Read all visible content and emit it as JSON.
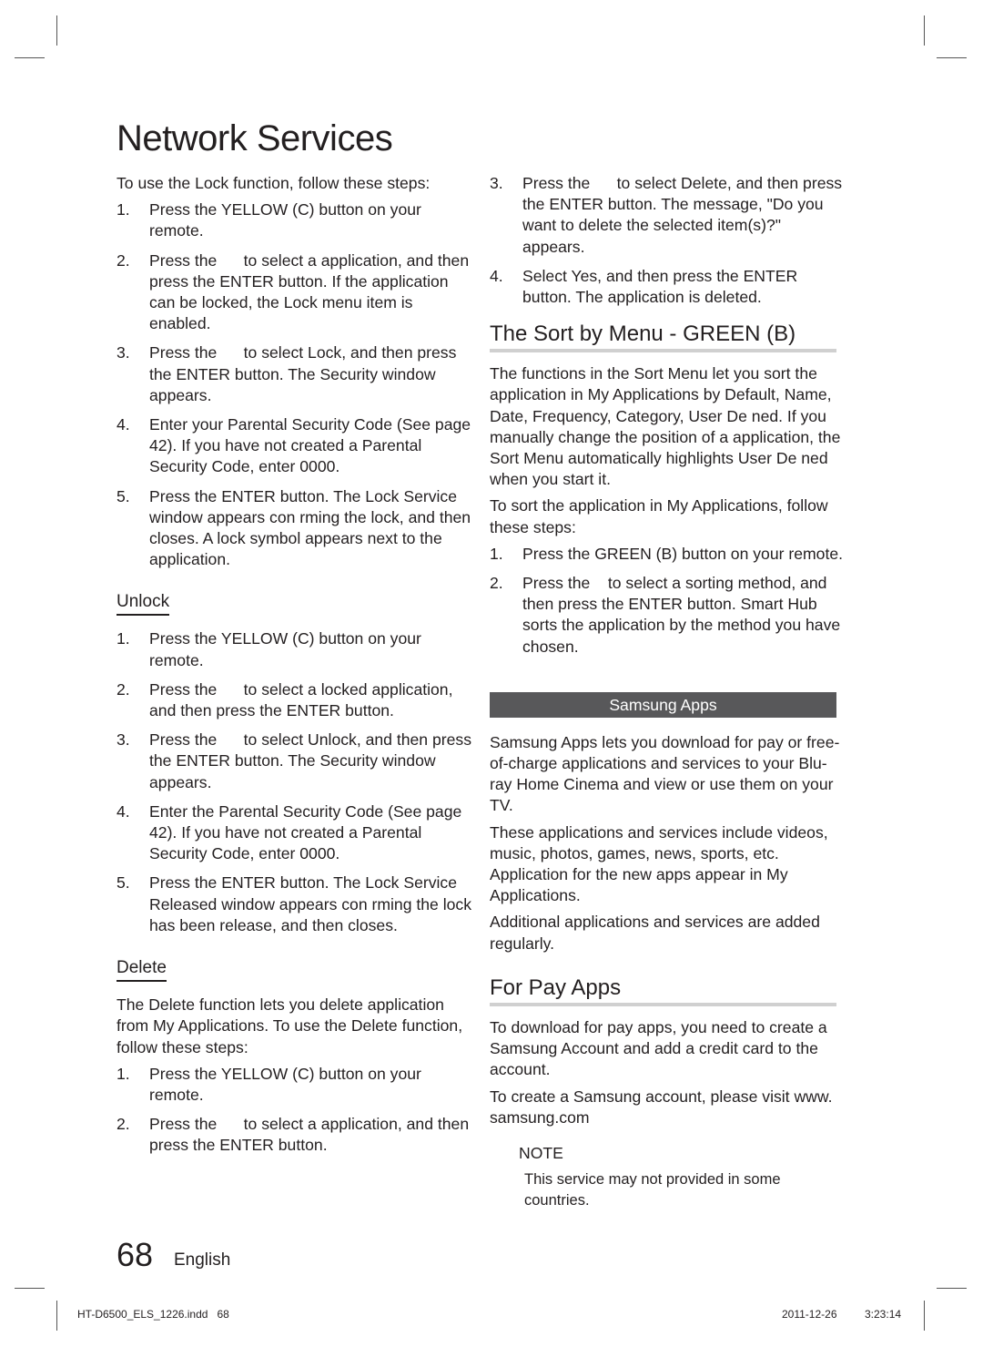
{
  "page": {
    "title": "Network Services",
    "page_number": "68",
    "language": "English"
  },
  "left_column": {
    "intro": "To use the Lock function, follow these steps:",
    "lock_steps": [
      {
        "num": "1.",
        "text": "Press the YELLOW (C) button on your remote."
      },
      {
        "num": "2.",
        "text": "Press the      to select a application, and then press the ENTER button. If the application can be locked, the Lock menu item is enabled."
      },
      {
        "num": "3.",
        "text": "Press the      to select Lock, and then press the ENTER button. The Security window appears."
      },
      {
        "num": "4.",
        "text": "Enter your Parental Security Code (See page 42). If you have not created a Parental Security Code, enter 0000."
      },
      {
        "num": "5.",
        "text": "Press the ENTER button. The Lock Service window appears con rming the lock, and then closes. A lock symbol appears next to the application."
      }
    ],
    "unlock": {
      "heading": "Unlock",
      "steps": [
        {
          "num": "1.",
          "text": "Press the YELLOW (C) button on your remote."
        },
        {
          "num": "2.",
          "text": "Press the      to select a locked application, and then press the ENTER button."
        },
        {
          "num": "3.",
          "text": "Press the      to select Unlock, and then press the ENTER button. The Security window appears."
        },
        {
          "num": "4.",
          "text": "Enter the Parental Security Code (See page 42). If you have not created a Parental Security Code, enter 0000."
        },
        {
          "num": "5.",
          "text": "Press the ENTER button. The Lock Service Released window appears con rming the lock has been release, and then closes."
        }
      ]
    },
    "delete": {
      "heading": "Delete",
      "intro": "The Delete function lets you delete application from My Applications. To use the Delete function, follow these steps:",
      "steps": [
        {
          "num": "1.",
          "text": "Press the YELLOW (C) button on your remote."
        },
        {
          "num": "2.",
          "text": "Press the      to select a application, and then press the ENTER button."
        }
      ]
    }
  },
  "right_column": {
    "delete_steps_cont": [
      {
        "num": "3.",
        "text": "Press the      to select Delete, and then press the ENTER button. The message, \"Do you want to delete the selected item(s)?\" appears."
      },
      {
        "num": "4.",
        "text": "Select Yes, and then press the ENTER button. The application is deleted."
      }
    ],
    "sort": {
      "heading": "The Sort by Menu - GREEN (B)",
      "paragraphs": [
        "The functions in the Sort Menu let you sort the application in My Applications by Default, Name, Date, Frequency, Category, User De ned. If you manually change the position of a application, the Sort Menu automatically highlights User De ned when you start it.",
        "To sort the application in My Applications, follow these steps:"
      ],
      "steps": [
        {
          "num": "1.",
          "text": "Press the GREEN (B) button on your remote."
        },
        {
          "num": "2.",
          "text": "Press the    to select a sorting method, and then press the ENTER button. Smart Hub sorts the application by the method you have chosen."
        }
      ]
    },
    "samsung_apps": {
      "bar_label": "Samsung Apps",
      "paragraphs": [
        "Samsung Apps lets you download for pay or free-of-charge applications and services to your Blu-ray Home Cinema and view or use them on your TV.",
        "These applications and services include videos, music, photos, games, news, sports, etc. Application for the new apps appear in My Applications.",
        "Additional applications and services are added regularly."
      ]
    },
    "for_pay": {
      "heading": "For Pay Apps",
      "paragraphs": [
        "To download for pay apps, you need to create a Samsung Account and add a credit card to the account.",
        "To create a Samsung account, please visit www. samsung.com"
      ],
      "note_label": "NOTE",
      "note_text": "This service may not provided in some countries."
    }
  },
  "footer": {
    "file_slug": "HT-D6500_ELS_1226.indd   68",
    "date": "2011-12-26",
    "time": "3:23:14"
  }
}
